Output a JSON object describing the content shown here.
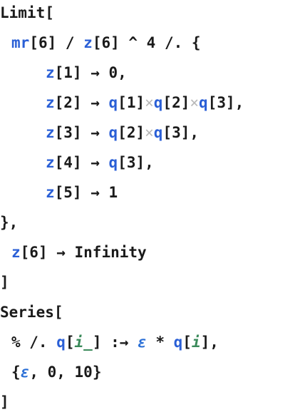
{
  "lines": [
    {
      "indent": 0,
      "tokens": [
        {
          "text": "Limit[",
          "kind": "k"
        }
      ]
    },
    {
      "indent": 1,
      "tokens": [
        {
          "text": "mr",
          "kind": "s"
        },
        {
          "text": "[6] / ",
          "kind": "k"
        },
        {
          "text": "z",
          "kind": "s"
        },
        {
          "text": "[6] ^ 4 /. {",
          "kind": "k"
        }
      ]
    },
    {
      "indent": 2,
      "tokens": [
        {
          "text": "z",
          "kind": "s"
        },
        {
          "text": "[1] → 0,",
          "kind": "k"
        }
      ]
    },
    {
      "indent": 2,
      "tokens": [
        {
          "text": "z",
          "kind": "s"
        },
        {
          "text": "[2] → ",
          "kind": "k"
        },
        {
          "text": "q",
          "kind": "s"
        },
        {
          "text": "[1]",
          "kind": "k"
        },
        {
          "text": "×",
          "kind": "f"
        },
        {
          "text": "q",
          "kind": "s"
        },
        {
          "text": "[2]",
          "kind": "k"
        },
        {
          "text": "×",
          "kind": "f"
        },
        {
          "text": "q",
          "kind": "s"
        },
        {
          "text": "[3],",
          "kind": "k"
        }
      ]
    },
    {
      "indent": 2,
      "tokens": [
        {
          "text": "z",
          "kind": "s"
        },
        {
          "text": "[3] → ",
          "kind": "k"
        },
        {
          "text": "q",
          "kind": "s"
        },
        {
          "text": "[2]",
          "kind": "k"
        },
        {
          "text": "×",
          "kind": "f"
        },
        {
          "text": "q",
          "kind": "s"
        },
        {
          "text": "[3],",
          "kind": "k"
        }
      ]
    },
    {
      "indent": 2,
      "tokens": [
        {
          "text": "z",
          "kind": "s"
        },
        {
          "text": "[4] → ",
          "kind": "k"
        },
        {
          "text": "q",
          "kind": "s"
        },
        {
          "text": "[3],",
          "kind": "k"
        }
      ]
    },
    {
      "indent": 2,
      "tokens": [
        {
          "text": "z",
          "kind": "s"
        },
        {
          "text": "[5] → 1",
          "kind": "k"
        }
      ]
    },
    {
      "indent": 0,
      "tokens": [
        {
          "text": "},",
          "kind": "k"
        }
      ]
    },
    {
      "indent": 1,
      "tokens": [
        {
          "text": "z",
          "kind": "s"
        },
        {
          "text": "[6] → Infinity",
          "kind": "k"
        }
      ]
    },
    {
      "indent": 0,
      "tokens": [
        {
          "text": "]",
          "kind": "k"
        }
      ]
    },
    {
      "indent": 0,
      "tokens": [
        {
          "text": "Series[",
          "kind": "k"
        }
      ]
    },
    {
      "indent": 1,
      "tokens": [
        {
          "text": "% /. ",
          "kind": "k"
        },
        {
          "text": "q",
          "kind": "s"
        },
        {
          "text": "[",
          "kind": "k"
        },
        {
          "text": "i_",
          "kind": "p"
        },
        {
          "text": "] :→ ",
          "kind": "k"
        },
        {
          "text": "ε",
          "kind": "g"
        },
        {
          "text": " * ",
          "kind": "k"
        },
        {
          "text": "q",
          "kind": "s"
        },
        {
          "text": "[",
          "kind": "k"
        },
        {
          "text": "i",
          "kind": "p"
        },
        {
          "text": "],",
          "kind": "k"
        }
      ]
    },
    {
      "indent": 1,
      "tokens": [
        {
          "text": "{",
          "kind": "k"
        },
        {
          "text": "ε",
          "kind": "g"
        },
        {
          "text": ", 0, 10}",
          "kind": "k"
        }
      ]
    },
    {
      "indent": 0,
      "tokens": [
        {
          "text": "]",
          "kind": "k"
        }
      ]
    }
  ]
}
